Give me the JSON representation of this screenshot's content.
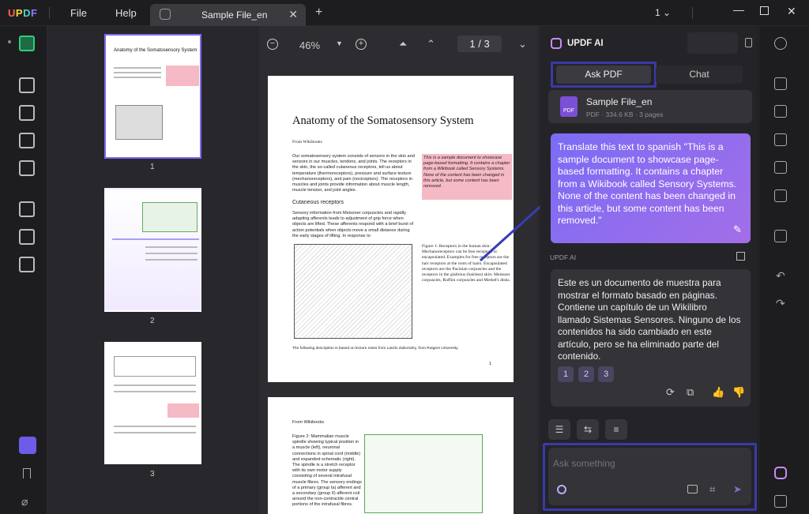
{
  "titlebar": {
    "logo": [
      "U",
      "P",
      "D",
      "F"
    ],
    "menu": [
      "File",
      "Help"
    ],
    "tab_title": "Sample File_en",
    "page_indicator": "1"
  },
  "thumbnails": {
    "thumb1_title": "Anatomy of the Somatosensory System",
    "pages": [
      "1",
      "2",
      "3"
    ]
  },
  "doc_toolbar": {
    "zoom": "46%",
    "page_current": "1",
    "page_sep": "/",
    "page_total": "3"
  },
  "document": {
    "title": "Anatomy of the Somatosensory System",
    "from": "From Wikibooks",
    "intro": "Our somatosensory system consists of sensors in the skin and sensors in our muscles, tendons, and joints. The receptors in the skin, the so-called cutaneous receptors, tell us about temperature (thermoreceptors), pressure and surface texture (mechanoreceptors), and pain (nociceptors). The receptors in muscles and joints provide information about muscle length, muscle tension, and joint angles.",
    "highlight_note": "This is a sample document to showcase page-based formatting. It contains a chapter from a Wikibook called Sensory Systems. None of the content has been changed in this article, but some content has been removed.",
    "section": "Cutaneous receptors",
    "section_text": "Sensory information from Meissner corpuscles and rapidly adapting afferents leads to adjustment of grip force when objects are lifted. These afferents respond with a brief burst of action potentials when objects move a small distance during the early stages of lifting. In response to",
    "figure_caption": "Figure 1: Receptors in the human skin: Mechanoreceptors can be free receptors or encapsulated. Examples for free receptors are the hair receptors at the roots of hairs. Encapsulated receptors are the Pacinian corpuscles and the receptors in the glabrous (hairless) skin: Meissner corpuscles, Ruffini corpuscles and Merkel's disks.",
    "footnote": "The following description is based on lecture notes from Laszlo Zaborszky, from Rutgers University.",
    "page_number": "1",
    "page2_from": "From Wikibooks",
    "page2_text": "Figure 2: Mammalian muscle spindle showing typical position in a muscle (left), neuronal connections in spinal cord (middle) and expanded schematic (right). The spindle is a stretch receptor with its own motor supply consisting of several intrafusal muscle fibres. The sensory endings of a primary (group Ia) afferent and a secondary (group II) afferent coil around the non-contractile central portions of the intrafusal fibres."
  },
  "ai_panel": {
    "title": "UPDF AI",
    "tab_ask": "Ask PDF",
    "tab_chat": "Chat",
    "file_name": "Sample File_en",
    "file_meta": "PDF · 334.6 KB · 3 pages",
    "file_badge": "PDF",
    "user_prompt": "Translate this text to spanish \"This is a sample document to showcase page-based formatting. It contains a chapter from a Wikibook called Sensory Systems. None of the content has been changed in this article, but some content has been removed.\"",
    "ai_label": "UPDF AI",
    "ai_response": "Este es un documento de muestra para mostrar el formato basado en páginas. Contiene un capítulo de un Wikilibro llamado Sistemas Sensores. Ninguno de los contenidos ha sido cambiado en este artículo, pero se ha eliminado parte del contenido.",
    "citations": [
      "1",
      "2",
      "3"
    ],
    "input_placeholder": "Ask something"
  },
  "colors": {
    "accent": "#6c5ce7",
    "highlight_box": "#3a3aa8",
    "user_bubble_start": "#7b6cf5",
    "user_bubble_end": "#a36ee8"
  }
}
